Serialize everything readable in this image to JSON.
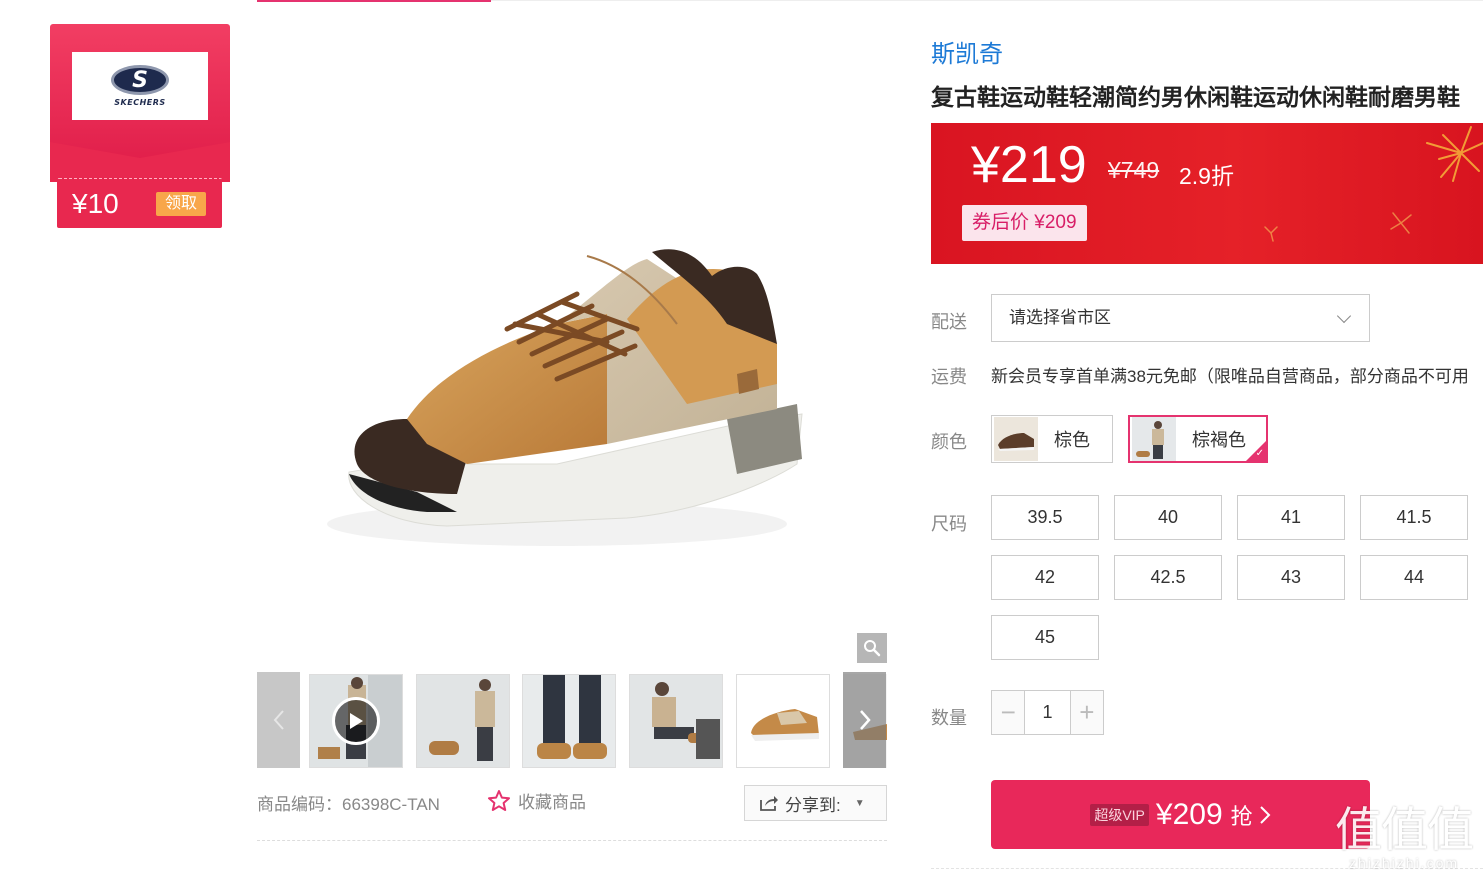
{
  "coupon": {
    "logo_text": "SKECHERS",
    "amount": "¥10",
    "get_label": "领取"
  },
  "gallery": {
    "thumbnail_count": 6,
    "product_code": "商品编码：66398C-TAN",
    "favorite_label": "收藏商品",
    "share_label": "分享到:"
  },
  "product": {
    "brand": "斯凯奇",
    "title": "复古鞋运动鞋轻潮简约男休闲鞋运动休闲鞋耐磨男鞋"
  },
  "price": {
    "current": "¥219",
    "original": "¥749",
    "discount": "2.9折",
    "after_coupon": "券后价 ¥209"
  },
  "delivery": {
    "label": "配送",
    "placeholder": "请选择省市区"
  },
  "shipping": {
    "label": "运费",
    "text": "新会员专享首单满38元免邮（限唯品自营商品，部分商品不可用"
  },
  "color": {
    "label": "颜色",
    "options": [
      "棕色",
      "棕褐色"
    ],
    "selected": "棕褐色"
  },
  "size": {
    "label": "尺码",
    "options": [
      "39.5",
      "40",
      "41",
      "41.5",
      "42",
      "42.5",
      "43",
      "44",
      "45"
    ]
  },
  "quantity": {
    "label": "数量",
    "value": "1",
    "minus": "−",
    "plus": "+"
  },
  "buy": {
    "vip_label": "超级VIP",
    "price": "¥209",
    "action": "抢"
  },
  "watermark": {
    "mark": "值值值",
    "site": "zhizhizhi.com"
  },
  "colors": {
    "accent": "#e5336f",
    "price_red": "#e52128",
    "brand_blue": "#1d7ad6",
    "buy_button": "#e8285a",
    "coupon_orange": "#f8a64a"
  }
}
